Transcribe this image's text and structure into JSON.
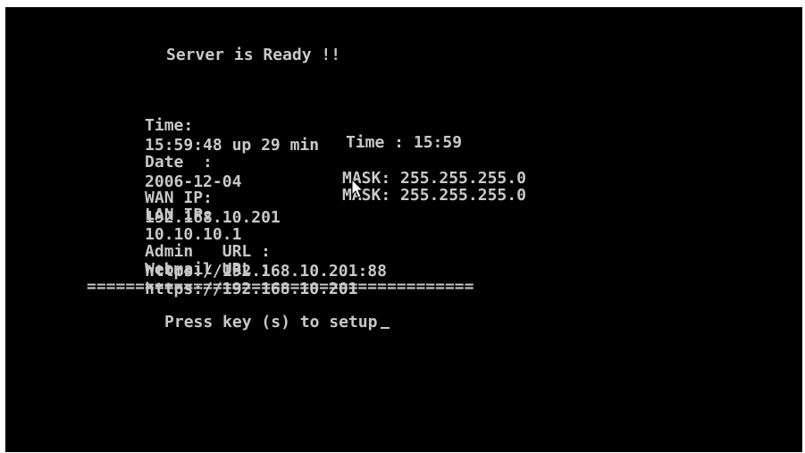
{
  "console": {
    "title": "Server is Ready !!",
    "uptime_label": "Time:",
    "uptime_value": "15:59:48 up 29 min",
    "date_label": "Date  :",
    "date_value": "2006-12-04",
    "time_label": "Time :",
    "time_value": "15:59",
    "wan_label": "WAN IP:",
    "wan_ip": "192.168.10.201",
    "wan_mask_label": "MASK:",
    "wan_mask": "255.255.255.0",
    "lan_label": "LAN IP:",
    "lan_ip": "10.10.10.1",
    "lan_mask_label": "MASK:",
    "lan_mask": "255.255.255.0",
    "admin_label": "Admin   URL :",
    "admin_url": "https://192.168.10.201:88",
    "webmail_label": "Webmail URL :",
    "webmail_url": "https://192.168.10.201",
    "separator": "========================================",
    "prompt": "Press key (s) to setup"
  },
  "colors": {
    "text": "#c8c8c8",
    "background": "#000000"
  },
  "icons": {
    "pointer": "mouse-pointer-icon",
    "cursor": "text-cursor-icon"
  }
}
